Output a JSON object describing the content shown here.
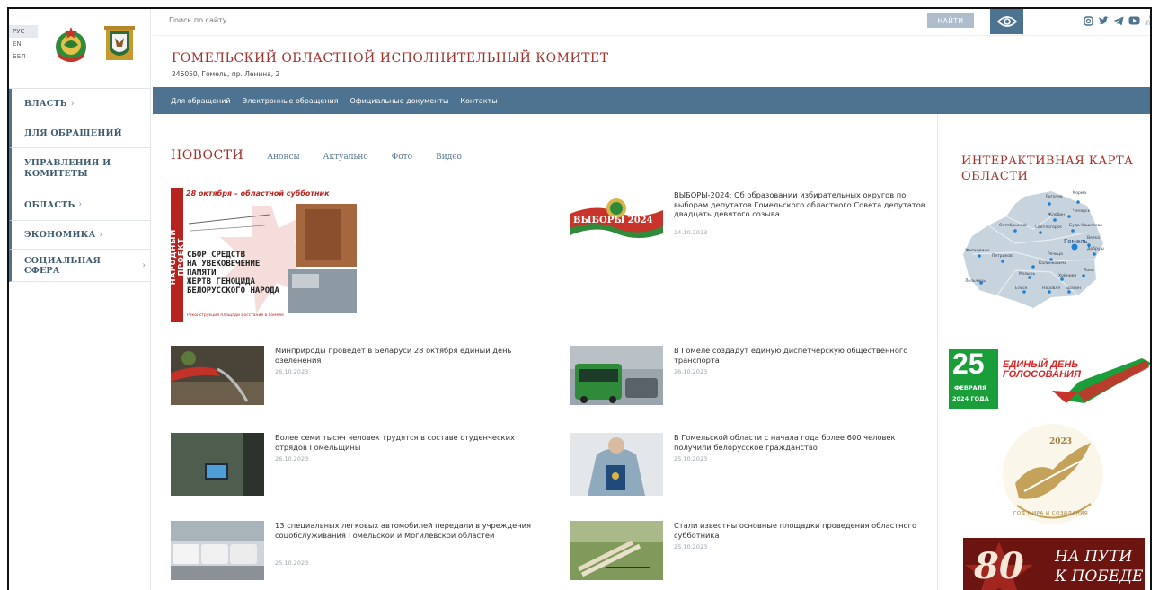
{
  "languages": [
    "РУС",
    "EN",
    "БЕЛ"
  ],
  "search": {
    "placeholder": "Поиск по сайту",
    "button_label": "НАЙТИ"
  },
  "header": {
    "org_name": "ГОМЕЛЬСКИЙ ОБЛАСТНОЙ ИСПОЛНИТЕЛЬНЫЙ КОМИТЕТ",
    "address": "246050, Гомель, пр. Ленина, 2"
  },
  "socials": [
    "instagram-icon",
    "twitter-icon",
    "telegram-icon",
    "youtube-icon",
    "sitemap-icon"
  ],
  "sidebar": {
    "items": [
      {
        "label": "ВЛАСТЬ",
        "has_submenu": true
      },
      {
        "label": "ДЛЯ ОБРАЩЕНИЙ",
        "has_submenu": false
      },
      {
        "label": "УПРАВЛЕНИЯ И КОМИТЕТЫ",
        "has_submenu": false
      },
      {
        "label": "ОБЛАСТЬ",
        "has_submenu": true
      },
      {
        "label": "ЭКОНОМИКА",
        "has_submenu": true
      },
      {
        "label": "СОЦИАЛЬНАЯ СФЕРА",
        "has_submenu": true
      }
    ]
  },
  "menu": [
    "Для обращений",
    "Электронные обращения",
    "Официальные документы",
    "Контакты"
  ],
  "news": {
    "title": "НОВОСТИ",
    "tabs": [
      "Анонсы",
      "Актуально",
      "Фото",
      "Видео"
    ],
    "featured": {
      "banner_title": "28 октября – областной субботник",
      "side_text": "НАРОДНЫЙ ПРОЕКТ",
      "body": [
        "СБОР СРЕДСТВ",
        "НА УВЕКОВЕЧЕНИЕ",
        "ПАМЯТИ",
        "ЖЕРТВ ГЕНОЦИДА",
        "БЕЛОРУССКОГО НАРОДА"
      ],
      "caption": "Реконструкция площади Восстания в Гомеле"
    },
    "elections": {
      "badge": "ВЫБОРЫ 2024",
      "text": "ВЫБОРЫ-2024: Об образовании избирательных округов по выборам депутатов Гомельского областного Совета депутатов двадцать девятого созыва",
      "date": "24.10.2023"
    },
    "items": [
      {
        "text": "Минприроды проведет в Беларуси 28 октября единый день озеленения",
        "date": "26.10.2023"
      },
      {
        "text": "В Гомеле создадут единую диспетчерскую общественного транспорта",
        "date": "26.10.2023"
      },
      {
        "text": "Более семи тысяч человек трудятся в составе студенческих отрядов Гомельщины",
        "date": "26.10.2023"
      },
      {
        "text": "В Гомельской области с начала года более 600 человек получили белорусское гражданство",
        "date": "25.10.2023"
      },
      {
        "text": "13 специальных легковых автомобилей передали в учреждения соцобслуживания Гомельской и Могилевской областей",
        "date": "25.10.2023"
      },
      {
        "text": "Стали известны основные площадки проведения областного субботника",
        "date": "25.10.2023"
      }
    ]
  },
  "map": {
    "title": "ИНТЕРАКТИВНАЯ КАРТА ОБЛАСТИ",
    "districts": [
      "Рогачев",
      "Корма",
      "Чечерск",
      "Жлобин",
      "Октябрьский",
      "Светлогорск",
      "Буда-Кошелево",
      "Гомель",
      "Ветка",
      "Житковичи",
      "Речица",
      "Добруш",
      "Петриков",
      "Калинковичи",
      "Мозырь",
      "Хойники",
      "Лоев",
      "Лельчицы",
      "Ельск",
      "Наровля",
      "Брагин"
    ]
  },
  "banners": {
    "voting": {
      "day": "25",
      "month": "ФЕВРАЛЯ",
      "year": "2024 ГОДА",
      "title": "ЕДИНЫЙ ДЕНЬ ГОЛОСОВАНИЯ"
    },
    "peace": {
      "year": "2023",
      "text": "ГОД МИРА И СОЗИДАНИЯ"
    },
    "victory": {
      "number": "80",
      "line1": "НА ПУТИ",
      "line2": "К ПОБЕДЕ"
    }
  },
  "colors": {
    "accent_red": "#a0302a",
    "nav_blue": "#4d7390",
    "green": "#1a9e3a"
  }
}
